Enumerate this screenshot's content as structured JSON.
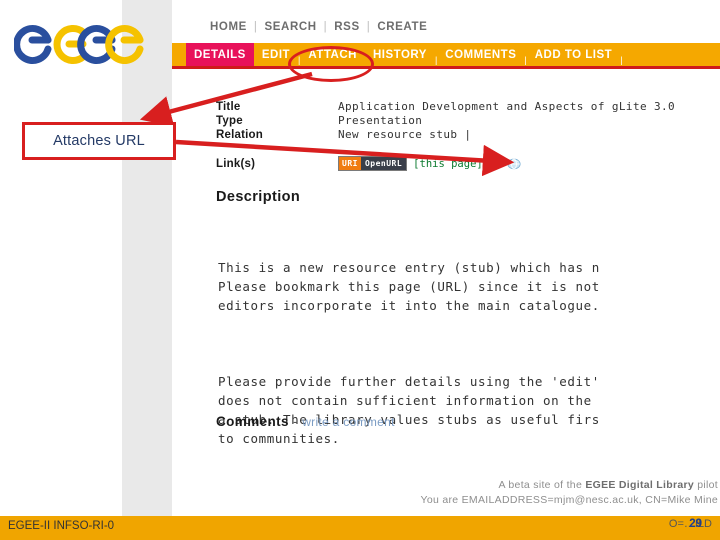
{
  "slide": {
    "logo_alt": "EGEE logo",
    "footer_left": "EGEE-II INFSO-RI-0",
    "page_number": "29",
    "page_ghost": "O=…ILD"
  },
  "annotation": {
    "callout_label": "Attaches URL",
    "highlight_target": "ATTACH",
    "accent_color": "#d81f1f",
    "callout_text_color": "#243a66"
  },
  "browser": {
    "topnav": {
      "items": [
        "HOME",
        "SEARCH",
        "RSS",
        "CREATE"
      ],
      "separator": "|"
    },
    "tabs": [
      {
        "label": "DETAILS",
        "active": true
      },
      {
        "label": "EDIT",
        "active": false
      },
      {
        "label": "ATTACH",
        "active": false
      },
      {
        "label": "HISTORY",
        "active": false
      },
      {
        "label": "COMMENTS",
        "active": false
      },
      {
        "label": "ADD TO LIST",
        "active": false
      }
    ],
    "tabbar_color": "#f5a800",
    "active_tab_color": "#e8125a",
    "metadata": [
      {
        "label": "Title",
        "value": "Application Development and Aspects of gLite 3.0"
      },
      {
        "label": "Type",
        "value": "Presentation"
      },
      {
        "label": "Relation",
        "value": "New resource stub |"
      }
    ],
    "links": {
      "label": "Link(s)",
      "badge_left": "URI",
      "badge_right": "OpenURL",
      "this_page": "[this page]",
      "globe_icon": "globe-icon",
      "badge_left_color": "#f07c12",
      "badge_right_color": "#3a3f4a",
      "this_page_color": "#0a7a2e"
    },
    "description": {
      "heading": "Description",
      "paragraph_1": "This is a new resource entry (stub) which has n\nPlease bookmark this page (URL) since it is not\neditors incorporate it into the main catalogue.",
      "paragraph_2": "Please provide further details using the 'edit'\ndoes not contain sufficient information on the\na stub. The library values stubs as useful firs\nto communities."
    },
    "comments": {
      "heading": "Comments",
      "dash": "-",
      "link": "write a comment",
      "link_color": "#7b9cc4"
    },
    "footer": {
      "line1_pre": "A beta site of the ",
      "line1_bold": "EGEE Digital Library",
      "line1_post": " pilot",
      "line2": "You are EMAILADDRESS=mjm@nesc.ac.uk, CN=Mike Mine"
    }
  }
}
